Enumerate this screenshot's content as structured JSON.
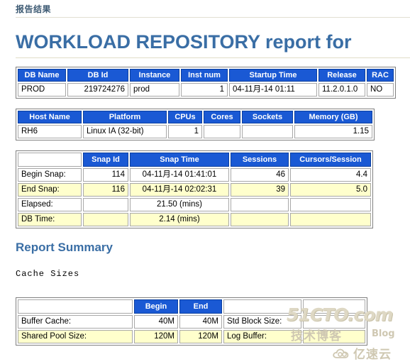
{
  "page": {
    "breadcrumb": "报告结果",
    "report_title": "WORKLOAD REPOSITORY report for",
    "section_summary_title": "Report Summary",
    "cache_sizes_label": "Cache Sizes"
  },
  "db_table": {
    "headers": [
      "DB Name",
      "DB Id",
      "Instance",
      "Inst num",
      "Startup Time",
      "Release",
      "RAC"
    ],
    "rows": [
      {
        "db_name": "PROD",
        "db_id": "219724276",
        "instance": "prod",
        "inst_num": "1",
        "startup_time": "04-11月-14 01:11",
        "release": "11.2.0.1.0",
        "rac": "NO"
      }
    ]
  },
  "host_table": {
    "headers": [
      "Host Name",
      "Platform",
      "CPUs",
      "Cores",
      "Sockets",
      "Memory (GB)"
    ],
    "rows": [
      {
        "host_name": "RH6",
        "platform": "Linux IA (32-bit)",
        "cpus": "1",
        "cores": "",
        "sockets": "",
        "memory_gb": "1.15"
      }
    ]
  },
  "snap_table": {
    "headers": [
      "",
      "Snap Id",
      "Snap Time",
      "Sessions",
      "Cursors/Session"
    ],
    "rows": [
      {
        "label": "Begin Snap:",
        "snap_id": "114",
        "snap_time": "04-11月-14 01:41:01",
        "sessions": "46",
        "cursors_session": "4.4"
      },
      {
        "label": "End Snap:",
        "snap_id": "116",
        "snap_time": "04-11月-14 02:02:31",
        "sessions": "39",
        "cursors_session": "5.0"
      },
      {
        "label": "Elapsed:",
        "snap_id": "",
        "snap_time": "21.50 (mins)",
        "sessions": "",
        "cursors_session": ""
      },
      {
        "label": "DB Time:",
        "snap_id": "",
        "snap_time": "2.14 (mins)",
        "sessions": "",
        "cursors_session": ""
      }
    ]
  },
  "cache_table": {
    "headers": [
      "",
      "Begin",
      "End",
      "",
      ""
    ],
    "rows": [
      {
        "label": "Buffer Cache:",
        "begin": "40M",
        "end": "40M",
        "label2": "Std Block Size:",
        "value2": ""
      },
      {
        "label": "Shared Pool Size:",
        "begin": "120M",
        "end": "120M",
        "label2": "Log Buffer:",
        "value2": ""
      }
    ]
  },
  "watermark": {
    "main": "51CTO.com",
    "cn": "技术博客",
    "blog": "Blog",
    "cloud": "亿速云"
  }
}
